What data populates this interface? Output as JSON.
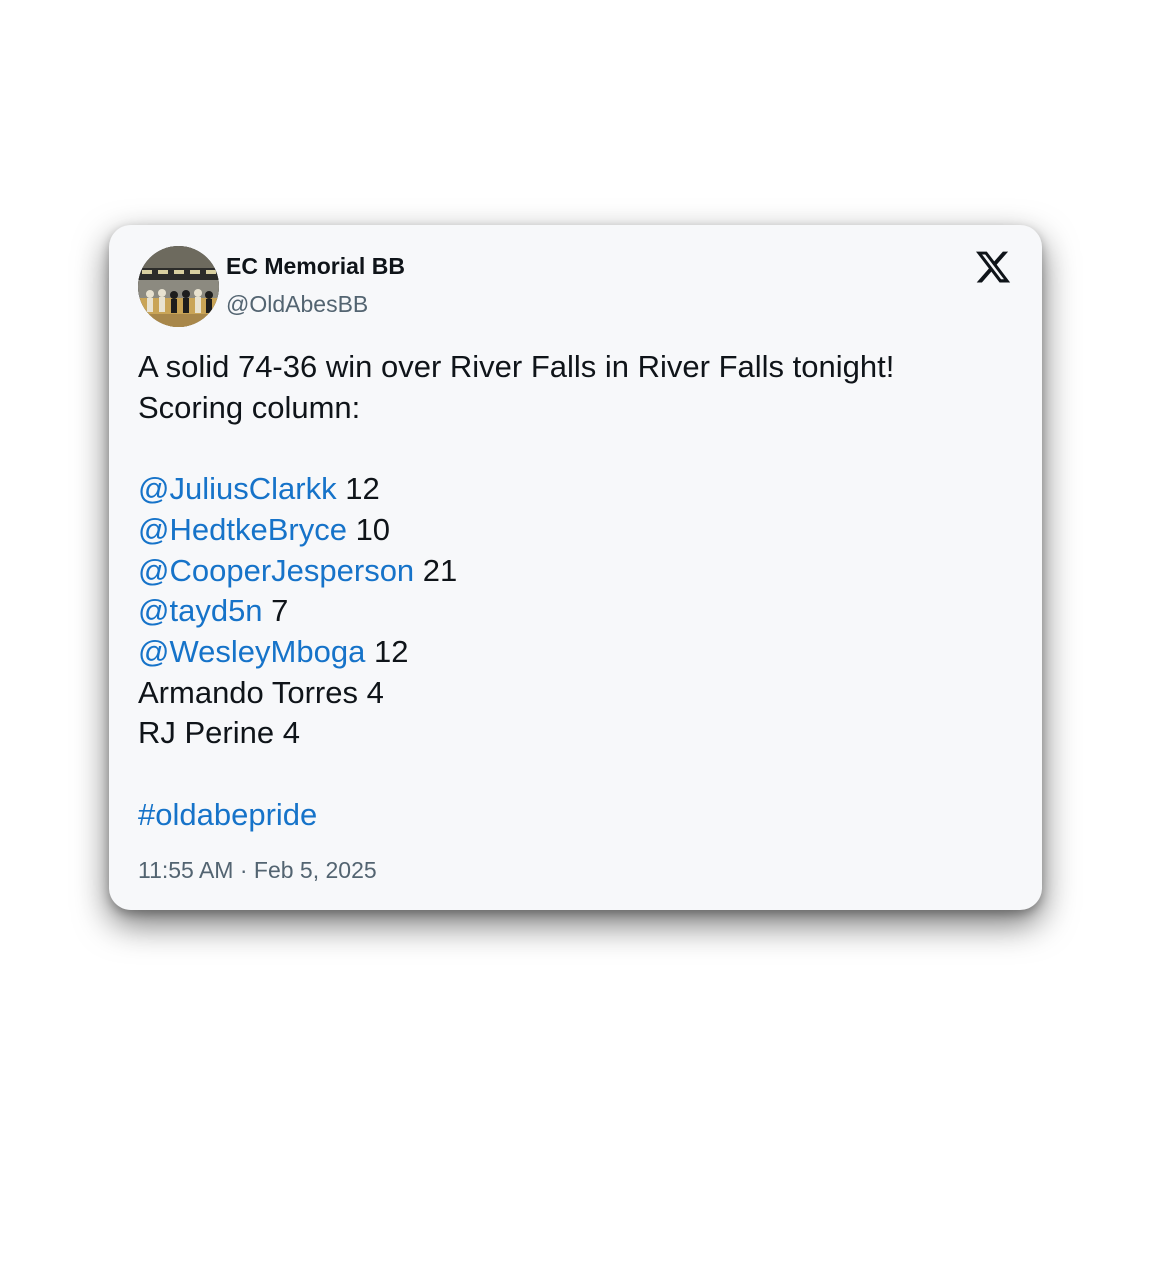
{
  "tweet": {
    "author": {
      "display_name": "EC Memorial BB",
      "handle": "@OldAbesBB",
      "avatar_icon": "gym-photo-avatar"
    },
    "brand_icon": "x-logo-icon",
    "body": {
      "intro_line1": "A solid 74-36 win over River Falls in River Falls tonight!",
      "intro_line2": "Scoring column:",
      "scorers": [
        {
          "mention": "@JuliusClarkk",
          "points": "12"
        },
        {
          "mention": "@HedtkeBryce",
          "points": "10"
        },
        {
          "mention": "@CooperJesperson",
          "points": "21"
        },
        {
          "mention": "@tayd5n",
          "points": "7"
        },
        {
          "mention": "@WesleyMboga",
          "points": "12"
        }
      ],
      "plain_scorers": [
        {
          "name": "Armando Torres",
          "points": "4"
        },
        {
          "name": "RJ Perine",
          "points": "4"
        }
      ],
      "hashtag": "#oldabepride"
    },
    "timestamp": "11:55 AM · Feb 5, 2025"
  },
  "colors": {
    "link": "#1673c9",
    "text": "#0f1419",
    "muted": "#536471",
    "card_background": "#f7f8fa"
  }
}
